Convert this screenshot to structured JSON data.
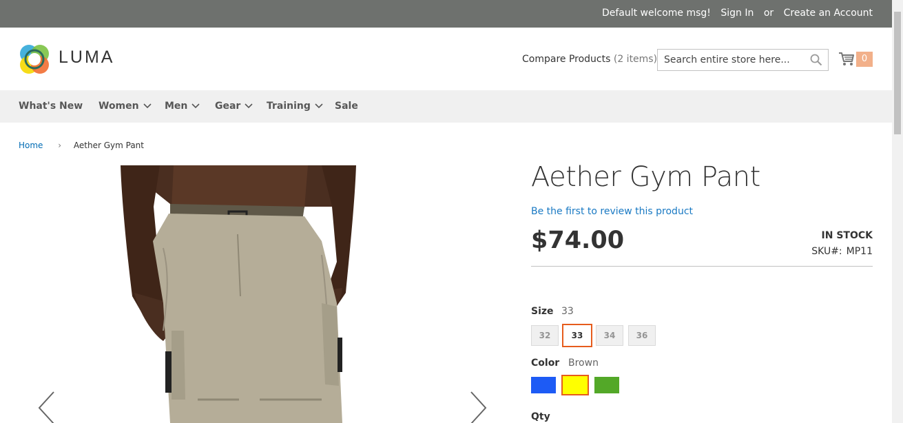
{
  "topbar": {
    "welcome": "Default welcome msg!",
    "sign_in": "Sign In",
    "or": "or",
    "create_account": "Create an Account"
  },
  "header": {
    "logo_text": "LUMA",
    "compare_label": "Compare Products",
    "compare_count": "(2 items)",
    "search_placeholder": "Search entire store here...",
    "cart_count": "0"
  },
  "nav": {
    "items": [
      {
        "label": "What's New",
        "has_dropdown": false
      },
      {
        "label": "Women",
        "has_dropdown": true
      },
      {
        "label": "Men",
        "has_dropdown": true
      },
      {
        "label": "Gear",
        "has_dropdown": true
      },
      {
        "label": "Training",
        "has_dropdown": true
      },
      {
        "label": "Sale",
        "has_dropdown": false
      }
    ]
  },
  "breadcrumb": {
    "home": "Home",
    "current": "Aether Gym Pant"
  },
  "product": {
    "title": "Aether Gym Pant",
    "review_link": "Be the first to review this product",
    "price": "$74.00",
    "stock": "IN STOCK",
    "sku_label": "SKU#:",
    "sku_value": "MP11"
  },
  "options": {
    "size": {
      "label": "Size",
      "selected": "33",
      "values": [
        "32",
        "33",
        "34",
        "36"
      ]
    },
    "color": {
      "label": "Color",
      "selected": "Brown",
      "swatches": [
        "#1d5bf5",
        "#ffff00",
        "#53a828"
      ]
    },
    "qty_label": "Qty"
  },
  "colors": {
    "topbar_bg": "#6e716e",
    "nav_bg": "#f0f0f0",
    "link": "#006bb4",
    "accent": "#e65c1c"
  }
}
